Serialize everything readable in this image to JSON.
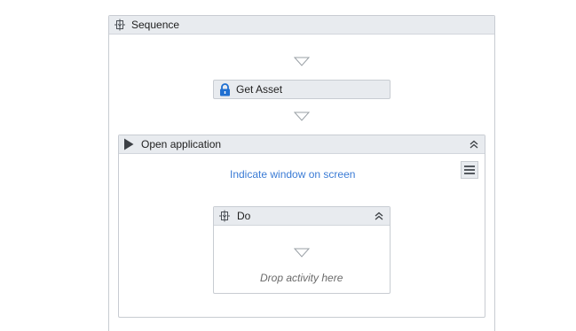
{
  "sequence": {
    "title": "Sequence",
    "icon": "sequence-icon"
  },
  "get_asset": {
    "title": "Get Asset",
    "icon": "lock-icon"
  },
  "open_application": {
    "title": "Open application",
    "icon": "play-icon",
    "indicate_link": "Indicate window on screen",
    "menu_icon": "hamburger-menu-icon"
  },
  "do_block": {
    "title": "Do",
    "icon": "sequence-icon",
    "drop_hint": "Drop activity here"
  },
  "colors": {
    "header_bg": "#e8ebef",
    "border": "#c8ccd2",
    "link": "#3a7bd5",
    "lock_blue": "#1f6fd1"
  }
}
